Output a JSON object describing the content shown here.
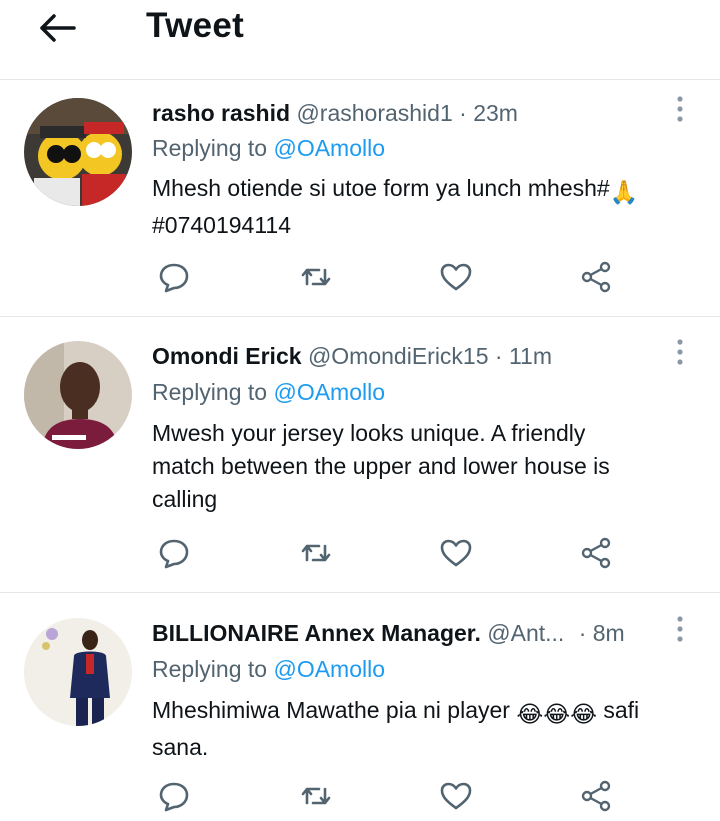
{
  "header": {
    "title": "Tweet",
    "back_icon": "arrow-left-icon"
  },
  "colors": {
    "link": "#1d9bf0",
    "secondary": "#536471",
    "primary": "#0f1419",
    "divider": "#e3e7ea"
  },
  "tweets": [
    {
      "name": "rasho rashid",
      "handle": "@rashorashid1",
      "dot": "·",
      "time": "23m",
      "replying_prefix": "Replying to",
      "replying_to": "@OAmollo",
      "text_line1": "Mhesh otiende si utoe form ya lunch mhesh#",
      "text_emoji": "🙏",
      "text_line2": "#0740194114",
      "avatar": "cartoon-avatar"
    },
    {
      "name": "Omondi Erick",
      "handle": "@OmondiErick15",
      "dot": "·",
      "time": "11m",
      "replying_prefix": "Replying to",
      "replying_to": "@OAmollo",
      "text_line1": "Mwesh your jersey looks unique. A friendly",
      "text_line2": "match between the upper and lower house is",
      "text_line3": "calling",
      "avatar": "photo-avatar"
    },
    {
      "name": "BILLIONAIRE Annex Manager.",
      "handle": "@Ant...",
      "dot": "·",
      "time": "8m",
      "replying_prefix": "Replying to",
      "replying_to": "@OAmollo",
      "text_line1": "Mheshimiwa Mawathe pia ni player",
      "text_emoji": "😂😂😂",
      "text_after": "safi",
      "text_line2": "sana.",
      "avatar": "photo-avatar"
    }
  ],
  "actions": [
    "reply-icon",
    "retweet-icon",
    "like-icon",
    "share-icon"
  ]
}
